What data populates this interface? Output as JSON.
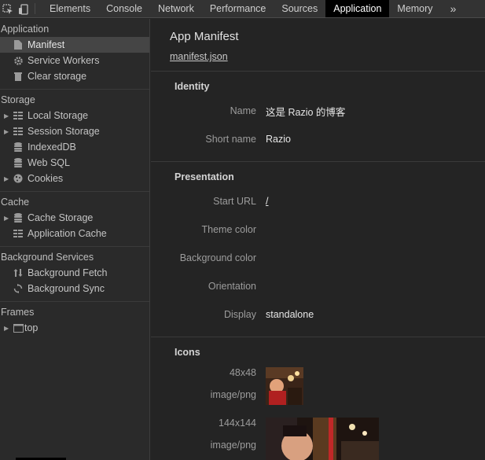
{
  "toolbar": {
    "inspect_icon": "cursor-select-icon",
    "device_icon": "device-toggle-icon",
    "tabs": [
      "Elements",
      "Console",
      "Network",
      "Performance",
      "Sources",
      "Application",
      "Memory"
    ],
    "more": "»",
    "active_tab": "Application"
  },
  "sidebar": {
    "application": {
      "title": "Application",
      "items": [
        {
          "label": "Manifest",
          "icon": "document-icon"
        },
        {
          "label": "Service Workers",
          "icon": "gear-icon"
        },
        {
          "label": "Clear storage",
          "icon": "trash-icon"
        }
      ]
    },
    "storage": {
      "title": "Storage",
      "items": [
        {
          "label": "Local Storage",
          "icon": "grid-icon"
        },
        {
          "label": "Session Storage",
          "icon": "grid-icon"
        },
        {
          "label": "IndexedDB",
          "icon": "database-icon"
        },
        {
          "label": "Web SQL",
          "icon": "database-icon"
        },
        {
          "label": "Cookies",
          "icon": "cookie-icon"
        }
      ]
    },
    "cache": {
      "title": "Cache",
      "items": [
        {
          "label": "Cache Storage",
          "icon": "database-icon"
        },
        {
          "label": "Application Cache",
          "icon": "grid-icon"
        }
      ]
    },
    "background": {
      "title": "Background Services",
      "items": [
        {
          "label": "Background Fetch",
          "icon": "up-down-arrows-icon"
        },
        {
          "label": "Background Sync",
          "icon": "sync-icon"
        }
      ]
    },
    "frames": {
      "title": "Frames",
      "items": [
        {
          "label": "top",
          "icon": "frame-icon"
        }
      ]
    }
  },
  "main": {
    "title": "App Manifest",
    "manifest_link": "manifest.json",
    "identity": {
      "title": "Identity",
      "name_label": "Name",
      "name_value": "这是 Razio 的博客",
      "short_name_label": "Short name",
      "short_name_value": "Razio"
    },
    "presentation": {
      "title": "Presentation",
      "start_url_label": "Start URL",
      "start_url_value": "/",
      "theme_color_label": "Theme color",
      "theme_color_value": "",
      "background_color_label": "Background color",
      "background_color_value": "",
      "orientation_label": "Orientation",
      "orientation_value": "",
      "display_label": "Display",
      "display_value": "standalone"
    },
    "icons": {
      "title": "Icons",
      "list": [
        {
          "size": "48x48",
          "type": "image/png"
        },
        {
          "size": "144x144",
          "type": "image/png"
        }
      ]
    }
  }
}
